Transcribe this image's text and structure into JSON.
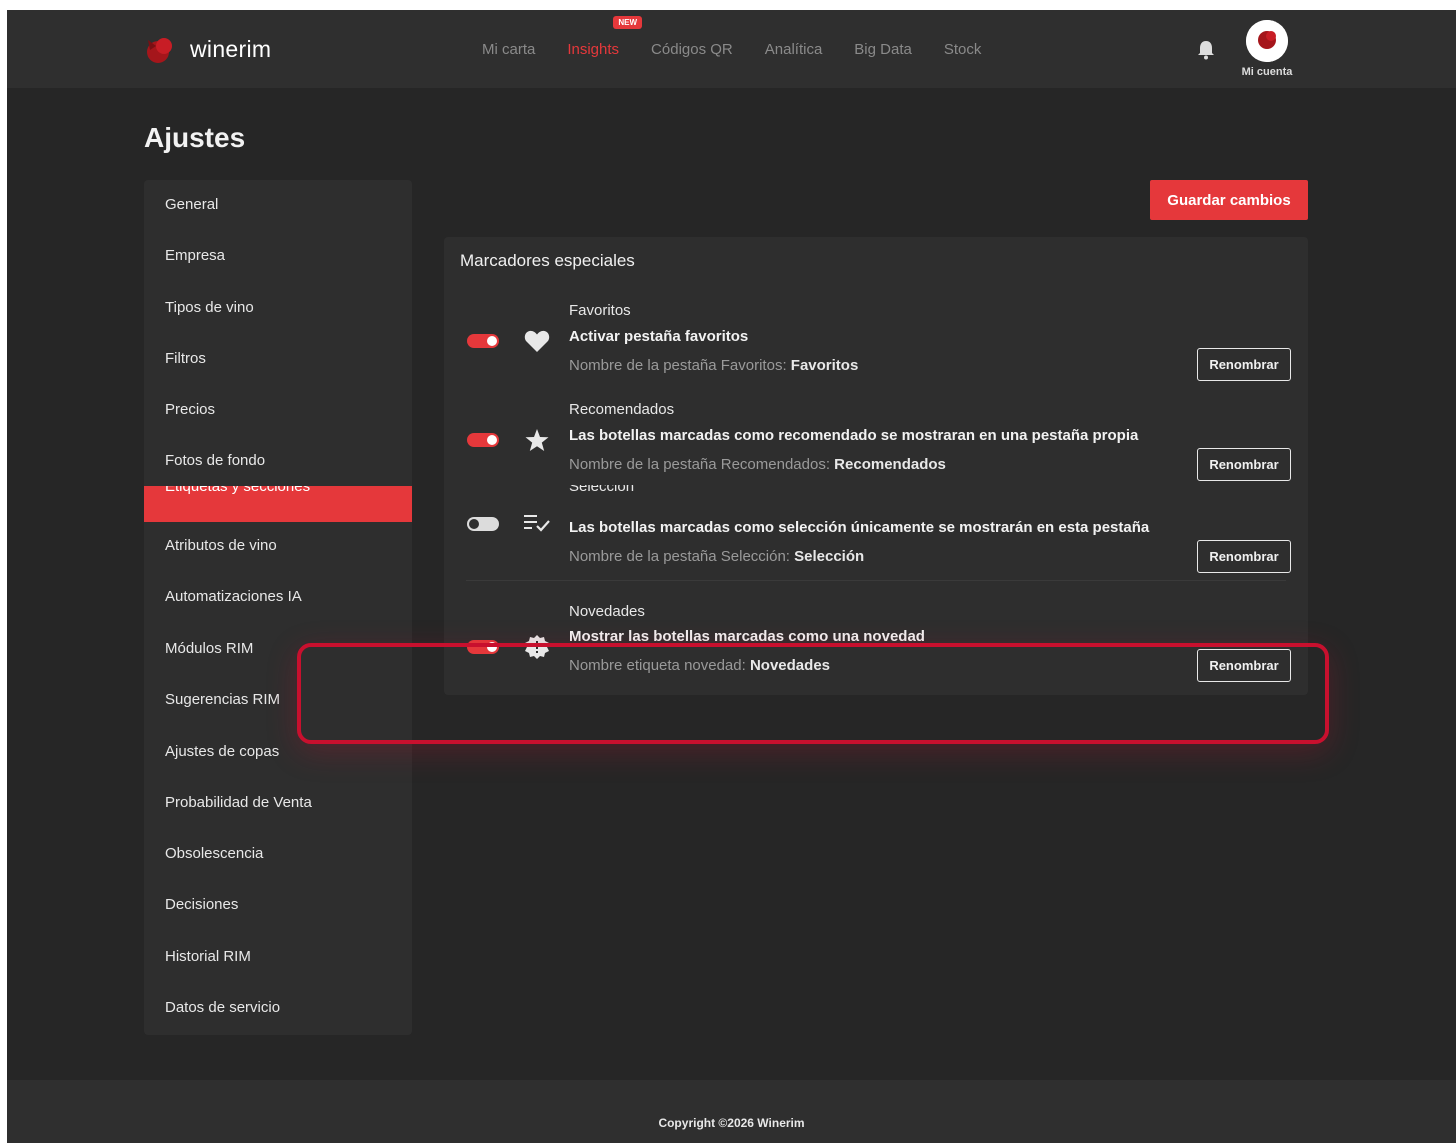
{
  "header": {
    "logo_text": "winerim",
    "nav": [
      {
        "label": "Mi carta",
        "active": false
      },
      {
        "label": "Insights",
        "active": true,
        "badge": "NEW"
      },
      {
        "label": "Códigos QR",
        "active": false
      },
      {
        "label": "Analítica",
        "active": false
      },
      {
        "label": "Big Data",
        "active": false
      },
      {
        "label": "Stock",
        "active": false
      }
    ],
    "account_label": "Mi cuenta"
  },
  "page": {
    "title": "Ajustes"
  },
  "sidebar": {
    "items": [
      {
        "label": "General"
      },
      {
        "label": "Empresa"
      },
      {
        "label": "Tipos de vino"
      },
      {
        "label": "Filtros"
      },
      {
        "label": "Precios"
      },
      {
        "label": "Fotos de fondo"
      },
      {
        "label": "Etiquetas y secciones",
        "active": true
      },
      {
        "label": "Atributos de vino"
      },
      {
        "label": "Automatizaciones IA"
      },
      {
        "label": "Módulos RIM"
      },
      {
        "label": "Sugerencias RIM"
      },
      {
        "label": "Ajustes de copas"
      },
      {
        "label": "Probabilidad de Venta"
      },
      {
        "label": "Obsolescencia"
      },
      {
        "label": "Decisiones"
      },
      {
        "label": "Historial RIM"
      },
      {
        "label": "Datos de servicio"
      }
    ]
  },
  "toolbar": {
    "save_label": "Guardar cambios"
  },
  "markers": {
    "title": "Marcadores especiales",
    "rows": [
      {
        "name": "Favoritos",
        "description": "Activar pestaña favoritos",
        "meta_label": "Nombre de la pestaña Favoritos:",
        "meta_value": "Favoritos",
        "enabled": true,
        "icon": "heart-icon",
        "button": "Renombrar"
      },
      {
        "name": "Recomendados",
        "description": "Las botellas marcadas como recomendado se mostraran en una pestaña propia",
        "meta_label": "Nombre de la pestaña Recomendados:",
        "meta_value": "Recomendados",
        "enabled": true,
        "icon": "star-icon",
        "button": "Renombrar"
      },
      {
        "name": "Selección",
        "description": "Las botellas marcadas como selección únicamente se mostrarán en esta pestaña",
        "meta_label": "Nombre de la pestaña Selección:",
        "meta_value": "Selección",
        "enabled": false,
        "icon": "playlist-check-icon",
        "button": "Renombrar"
      },
      {
        "name": "Novedades",
        "description": "Mostrar las botellas marcadas como una novedad",
        "meta_label": "Nombre etiqueta novedad:",
        "meta_value": "Novedades",
        "enabled": true,
        "icon": "new-badge-icon",
        "button": "Renombrar"
      }
    ]
  },
  "footer": {
    "copyright": "Copyright ©2026 Winerim"
  },
  "colors": {
    "accent": "#e5383b",
    "background": "#262626",
    "panel": "#2e2e2e",
    "highlight": "#c8102e"
  }
}
